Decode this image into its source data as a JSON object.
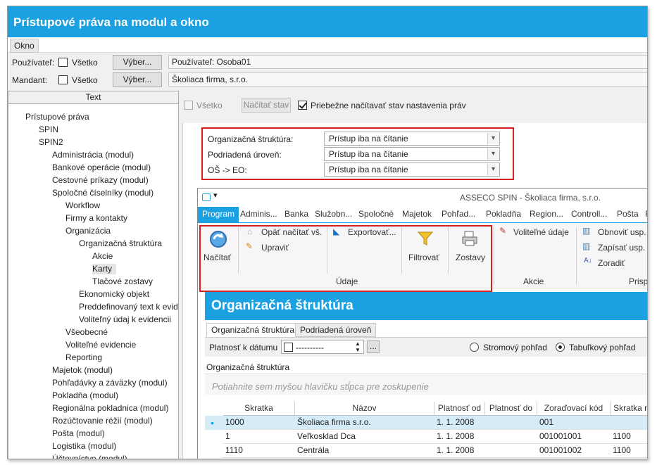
{
  "window": {
    "title": "Prístupové práva na modul a okno"
  },
  "menu": {
    "okno": "Okno"
  },
  "user_row": {
    "label": "Používateľ:",
    "all_label": "Všetko",
    "select_label": "Výber...",
    "value": "Používateľ: Osoba01"
  },
  "mandant_row": {
    "label": "Mandant:",
    "all_label": "Všetko",
    "select_label": "Výber...",
    "value": "Školiaca firma, s.r.o."
  },
  "tree": {
    "header": "Text",
    "nodes": [
      "Prístupové práva",
      "SPIN",
      "SPIN2",
      "Administrácia (modul)",
      "Bankové operácie (modul)",
      "Cestovné príkazy (modul)",
      "Spoločné číselníky (modul)",
      "Workflow",
      "Firmy a kontakty",
      "Organizácia",
      "Organizačná štruktúra",
      "Akcie",
      "Karty",
      "Tlačové zostavy",
      "Ekonomický objekt",
      "Preddefinovaný text k evidencii",
      "Voliteľný údaj k evidencii",
      "Všeobecné",
      "Voliteľné evidencie",
      "Reporting",
      "Majetok (modul)",
      "Pohľadávky a záväzky (modul)",
      "Pokladňa (modul)",
      "Regionálna pokladnica (modul)",
      "Rozúčtovanie réžií (modul)",
      "Pošta (modul)",
      "Logistika (modul)",
      "Účtovníctvo (modul)"
    ]
  },
  "toolbar": {
    "all_label": "Všetko",
    "load_label": "Načítať stav",
    "auto_label": "Priebežne načítavať stav nastavenia práv"
  },
  "permissions": [
    {
      "label": "Organizačná štruktúra:",
      "value": "Prístup iba na čítanie"
    },
    {
      "label": "Podriadená úroveň:",
      "value": "Prístup iba na čítanie"
    },
    {
      "label": "OŠ -> EO:",
      "value": "Prístup iba na čítanie"
    }
  ],
  "app": {
    "title": "ASSECO SPIN - Školiaca firma, s.r.o.",
    "tabs": [
      "Program",
      "Adminis...",
      "Banka",
      "Služobn...",
      "Spoločné",
      "Majetok",
      "Pohľad...",
      "Pokladňa",
      "Region...",
      "Controll...",
      "Pošta",
      "Fa"
    ],
    "ribbon": {
      "load": "Načítať",
      "reload": "Opäť načítať vš.",
      "edit": "Upraviť",
      "export": "Exportovať...",
      "filter": "Filtrovať",
      "reports": "Zostavy",
      "group_data": "Údaje",
      "optional": "Voliteľné údaje",
      "group_actions": "Akcie",
      "refresh": "Obnoviť usp.",
      "write": "Zapísať usp.",
      "sort": "Zoradiť",
      "group_view": "Prispô"
    },
    "org": {
      "title": "Organizačná štruktúra",
      "tab1": "Organizačná štruktúra",
      "tab2": "Podriadená úroveň",
      "validity_label": "Platnosť k dátumu",
      "date_value": "----------",
      "date_btn": "...",
      "tree_view": "Stromový pohľad",
      "table_view": "Tabuľkový pohľad",
      "section": "Organizačná štruktúra",
      "group_hint": "Potiahnite sem myšou hlavičku stĺpca pre zoskupenie",
      "columns": [
        "Skratka",
        "Názov",
        "Platnosť od",
        "Platnosť do",
        "Zoraďovací kód",
        "Skratka n"
      ],
      "rows": [
        [
          "1000",
          "Školiaca firma  s.r.o.",
          "1. 1. 2008",
          "",
          "001",
          ""
        ],
        [
          "1",
          "Veľkosklad Dca",
          "1. 1. 2008",
          "",
          "001001001",
          "1100"
        ],
        [
          "1110",
          "Centrála",
          "1. 1. 2008",
          "",
          "001001002",
          "1100"
        ]
      ]
    }
  },
  "colors": {
    "accent": "#1ba1e2",
    "highlight": "#d62020"
  }
}
